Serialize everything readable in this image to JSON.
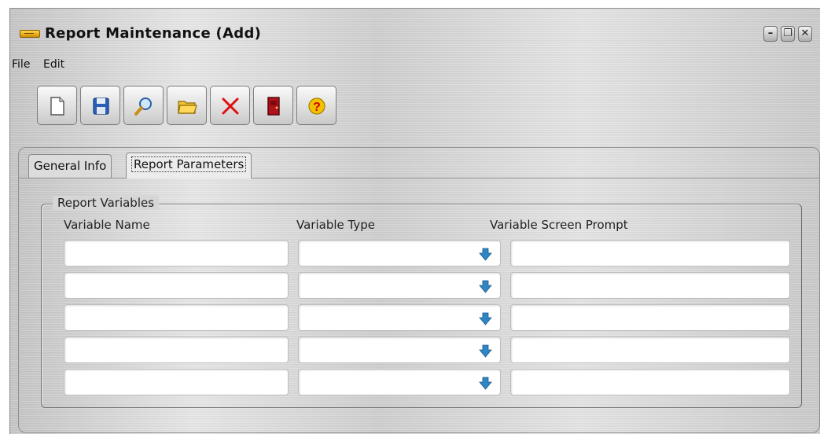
{
  "window": {
    "title": "Report Maintenance (Add)",
    "controls": [
      "minimize-icon",
      "restore-icon",
      "close-icon"
    ]
  },
  "menu": {
    "file": "File",
    "edit": "Edit"
  },
  "toolbar": {
    "buttons": [
      {
        "name": "new-button",
        "icon": "new-document-icon"
      },
      {
        "name": "save-button",
        "icon": "floppy-disk-icon"
      },
      {
        "name": "find-button",
        "icon": "magnifier-icon"
      },
      {
        "name": "open-button",
        "icon": "folder-icon"
      },
      {
        "name": "delete-button",
        "icon": "red-x-icon"
      },
      {
        "name": "exit-button",
        "icon": "door-icon"
      },
      {
        "name": "help-button",
        "icon": "question-mark-icon"
      }
    ]
  },
  "tabs": {
    "general": "General Info",
    "parameters": "Report Parameters",
    "active": "Report Parameters"
  },
  "report_variables": {
    "legend": "Report Variables",
    "columns": {
      "name": "Variable Name",
      "type": "Variable Type",
      "prompt": "Variable Screen Prompt"
    },
    "rows": [
      {
        "name": "",
        "type": "",
        "prompt": ""
      },
      {
        "name": "",
        "type": "",
        "prompt": ""
      },
      {
        "name": "",
        "type": "",
        "prompt": ""
      },
      {
        "name": "",
        "type": "",
        "prompt": ""
      },
      {
        "name": "",
        "type": "",
        "prompt": ""
      }
    ]
  },
  "colors": {
    "dropdown_arrow": "#2f86c4",
    "delete_x": "#e01010",
    "help_circle": "#f2c200",
    "exit_door": "#b0121a"
  }
}
